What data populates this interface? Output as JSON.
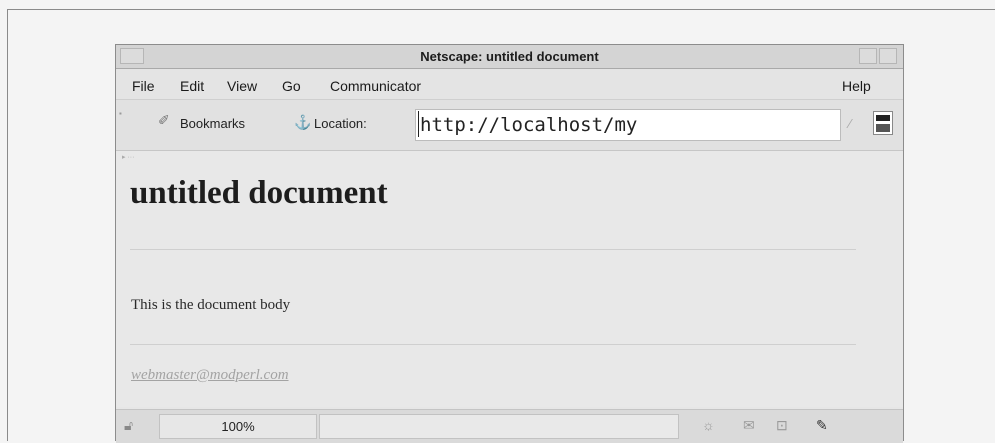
{
  "window": {
    "title": "Netscape: untitled document"
  },
  "menu": {
    "file": "File",
    "edit": "Edit",
    "view": "View",
    "go": "Go",
    "communicator": "Communicator",
    "help": "Help"
  },
  "location_bar": {
    "bookmarks_label": "Bookmarks",
    "location_label": "Location:",
    "url_value": "http://localhost/my"
  },
  "document": {
    "heading": "untitled document",
    "body_text": "This is the document body",
    "link_text": "webmaster@modperl.com"
  },
  "status_bar": {
    "zoom": "100%"
  },
  "icons": {
    "bookmarks": "bookmark-icon",
    "location": "location-icon",
    "page_proxy": "page-proxy-icon",
    "activity": "netscape-activity-icon",
    "security": "security-icon",
    "mail": "mail-icon",
    "composer": "composer-icon",
    "discussion": "discussion-icon",
    "offline": "offline-icon"
  },
  "colors": {
    "window_bg": "#e6e6e6",
    "link": "#a3a3a3"
  }
}
